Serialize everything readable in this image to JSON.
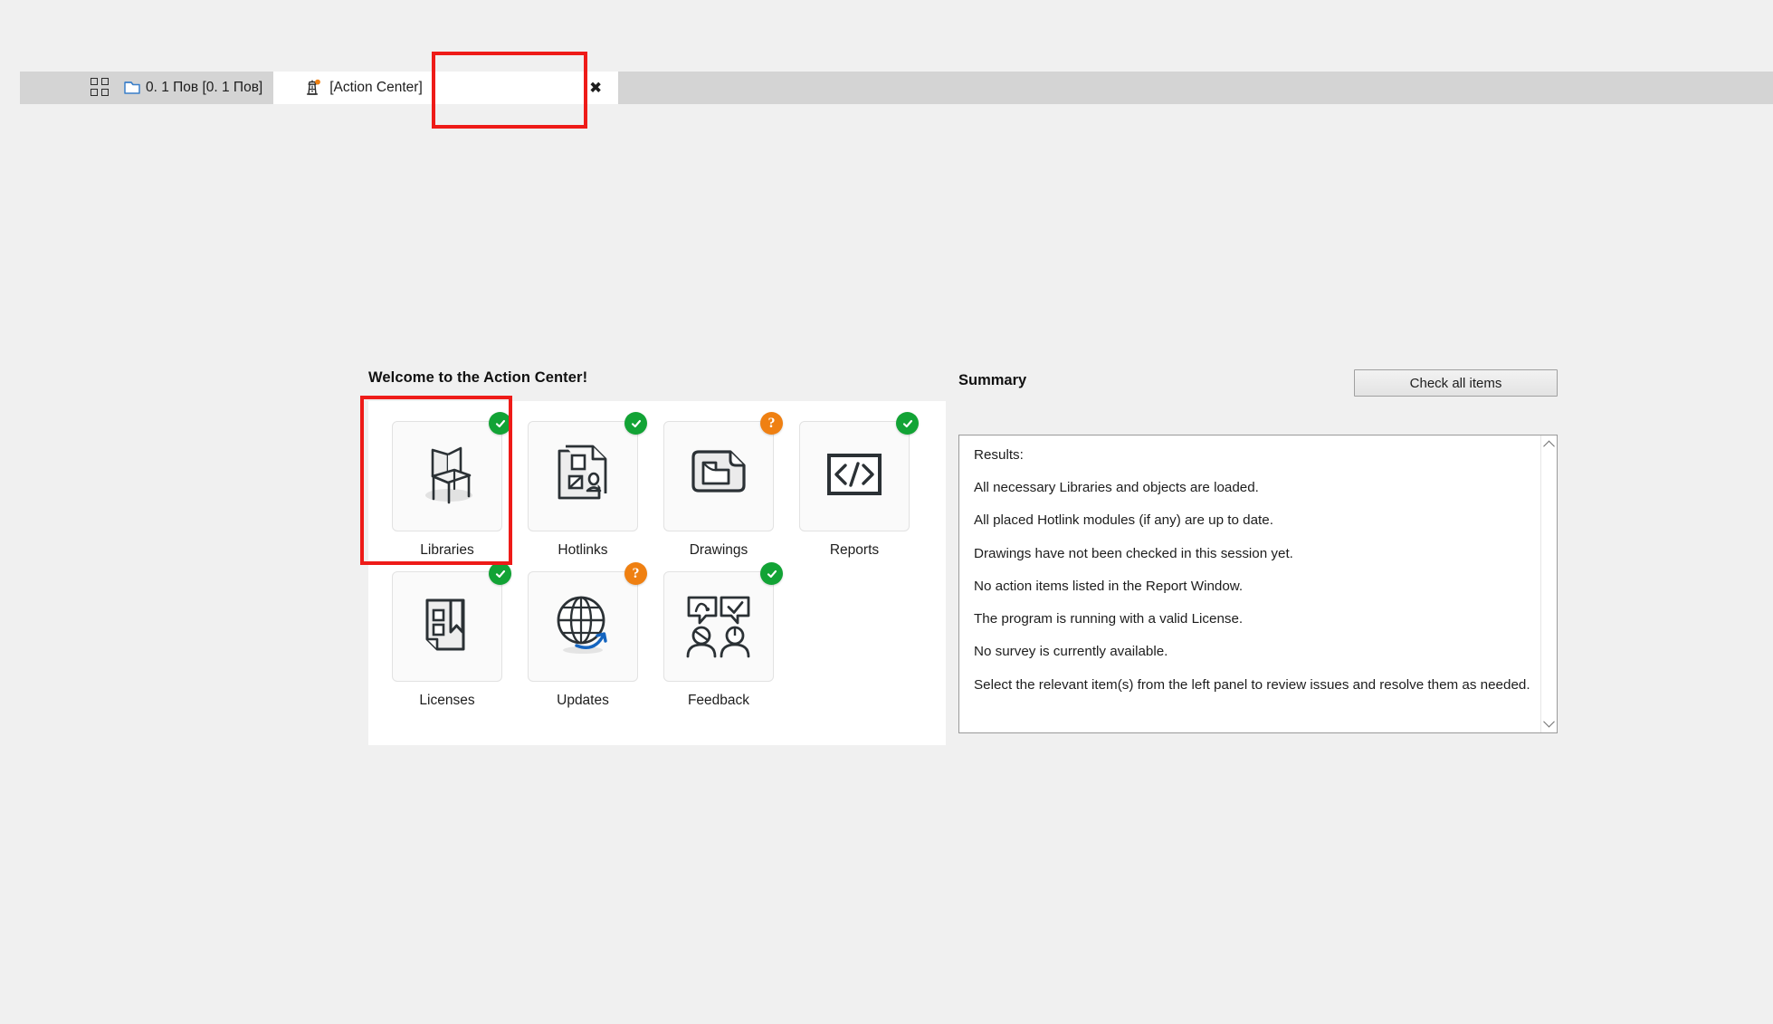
{
  "tabbar": {
    "tabs": [
      {
        "label": "0. 1 Пов [0. 1 Пов]",
        "icon": "story-layer-icon",
        "active": false
      },
      {
        "label": "[Action Center]",
        "icon": "beacon-icon",
        "active": true,
        "close_label": "✖"
      }
    ]
  },
  "main": {
    "welcome_title": "Welcome to the Action Center!",
    "tiles": [
      {
        "label": "Libraries",
        "icon": "chair-icon",
        "status": "ok",
        "badge_glyph": ""
      },
      {
        "label": "Hotlinks",
        "icon": "document-person-icon",
        "status": "ok",
        "badge_glyph": ""
      },
      {
        "label": "Drawings",
        "icon": "drawing-folder-icon",
        "status": "question",
        "badge_glyph": "?"
      },
      {
        "label": "Reports",
        "icon": "code-brackets-icon",
        "status": "ok",
        "badge_glyph": ""
      },
      {
        "label": "Licenses",
        "icon": "bookmark-document-icon",
        "status": "ok",
        "badge_glyph": ""
      },
      {
        "label": "Updates",
        "icon": "globe-refresh-icon",
        "status": "question",
        "badge_glyph": "?"
      },
      {
        "label": "Feedback",
        "icon": "speech-people-icon",
        "status": "ok",
        "badge_glyph": ""
      }
    ]
  },
  "summary": {
    "title": "Summary",
    "check_all_label": "Check all items",
    "results_heading": "Results:",
    "results": [
      "All necessary Libraries and objects are loaded.",
      "All placed Hotlink modules (if any) are up to date.",
      "Drawings have not been checked in this session yet.",
      "No action items listed in the Report Window.",
      "The program is running with a valid License.",
      "No survey is currently available.",
      "Select the relevant item(s) from the left panel to review issues and resolve them as needed."
    ]
  },
  "colors": {
    "status_ok": "#12a335",
    "status_question": "#ef8012",
    "highlight": "#ee1b18",
    "tab_active_bg": "#ffffff",
    "tabbar_bg": "#d4d4d4",
    "app_bg": "#f0f0f0"
  }
}
